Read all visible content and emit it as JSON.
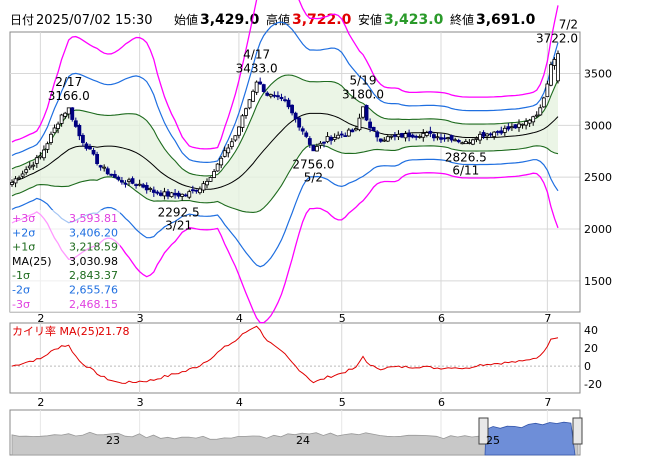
{
  "header": {
    "date_label": "日付",
    "datetime": "2025/07/02 15:30",
    "open_label": "始値",
    "open": "3,429.0",
    "high_label": "高値",
    "high": "3,722.0",
    "low_label": "安値",
    "low": "3,423.0",
    "close_label": "終値",
    "close": "3,691.0"
  },
  "colors": {
    "up": "#000000",
    "down": "#000080",
    "sigma3": "#ff00ff",
    "sigma2": "#1f6fe0",
    "sigma1": "#1e6b1e",
    "ma": "#000000",
    "kairi": "#e00000",
    "volume_fill": "#c8c8c8",
    "nav_fill": "#6e8ed8"
  },
  "chart_data": [
    {
      "type": "candlestick",
      "ylim": [
        1200,
        3900
      ],
      "y_ticks": [
        1500,
        2000,
        2500,
        3000,
        3500
      ],
      "month_ticks": [
        {
          "label": "2",
          "x": 8
        },
        {
          "label": "3",
          "x": 36
        },
        {
          "label": "4",
          "x": 64
        },
        {
          "label": "5",
          "x": 93
        },
        {
          "label": "6",
          "x": 121
        },
        {
          "label": "7",
          "x": 151
        }
      ],
      "num_days": 155,
      "anchors": [
        [
          0,
          2450
        ],
        [
          8,
          2700
        ],
        [
          14,
          3100
        ],
        [
          16,
          3160
        ],
        [
          19,
          2900
        ],
        [
          25,
          2600
        ],
        [
          30,
          2470
        ],
        [
          36,
          2430
        ],
        [
          40,
          2360
        ],
        [
          44,
          2330
        ],
        [
          49,
          2330
        ],
        [
          53,
          2400
        ],
        [
          57,
          2560
        ],
        [
          61,
          2790
        ],
        [
          63,
          2900
        ],
        [
          67,
          3250
        ],
        [
          69,
          3430
        ],
        [
          72,
          3300
        ],
        [
          77,
          3220
        ],
        [
          83,
          2900
        ],
        [
          85,
          2760
        ],
        [
          89,
          2870
        ],
        [
          93,
          2910
        ],
        [
          97,
          2950
        ],
        [
          99,
          3180
        ],
        [
          101,
          2960
        ],
        [
          104,
          2870
        ],
        [
          110,
          2900
        ],
        [
          116,
          2920
        ],
        [
          120,
          2890
        ],
        [
          124,
          2880
        ],
        [
          128,
          2830
        ],
        [
          131,
          2900
        ],
        [
          138,
          2950
        ],
        [
          144,
          3000
        ],
        [
          149,
          3150
        ],
        [
          151,
          3420
        ],
        [
          152,
          3600
        ],
        [
          154,
          3691
        ]
      ],
      "sigma": {
        "base": 130,
        "growth": 25
      },
      "annotations": [
        {
          "type": "high",
          "day": 16,
          "date": "2/17",
          "price": "3166.0",
          "value": 3166
        },
        {
          "type": "low",
          "day": 47,
          "date": "3/21",
          "price": "2292.5",
          "value": 2292.5
        },
        {
          "type": "high",
          "day": 69,
          "date": "4/17",
          "price": "3433.0",
          "value": 3433
        },
        {
          "type": "low",
          "day": 85,
          "date": "5/2",
          "price": "2756.0",
          "value": 2756
        },
        {
          "type": "high",
          "day": 99,
          "date": "5/19",
          "price": "3180.0",
          "value": 3180
        },
        {
          "type": "low",
          "day": 128,
          "date": "6/11",
          "price": "2826.5",
          "value": 2826.5
        },
        {
          "type": "high",
          "day": 154,
          "date": "7/2",
          "price": "3722.0",
          "value": 3722
        }
      ],
      "legend": [
        {
          "label": "+3σ",
          "value": "3,593.81",
          "color": "#e040e0"
        },
        {
          "label": "+2σ",
          "value": "3,406.20",
          "color": "#1f6fe0"
        },
        {
          "label": "+1σ",
          "value": "3,218.59",
          "color": "#1e6b1e"
        },
        {
          "label": "MA(25)",
          "value": "3,030.98",
          "color": "#000000"
        },
        {
          "label": "-1σ",
          "value": "2,843.37",
          "color": "#1e6b1e"
        },
        {
          "label": "-2σ",
          "value": "2,655.76",
          "color": "#1f6fe0"
        },
        {
          "label": "-3σ",
          "value": "2,468.15",
          "color": "#e040e0"
        }
      ]
    },
    {
      "type": "line",
      "title": "カイリ率 MA(25)",
      "last_value": "21.78",
      "ylim": [
        -30,
        48
      ],
      "y_ticks": [
        40,
        20,
        0,
        -20
      ]
    },
    {
      "type": "area",
      "period_labels": [
        "23",
        "24",
        "25"
      ]
    }
  ]
}
